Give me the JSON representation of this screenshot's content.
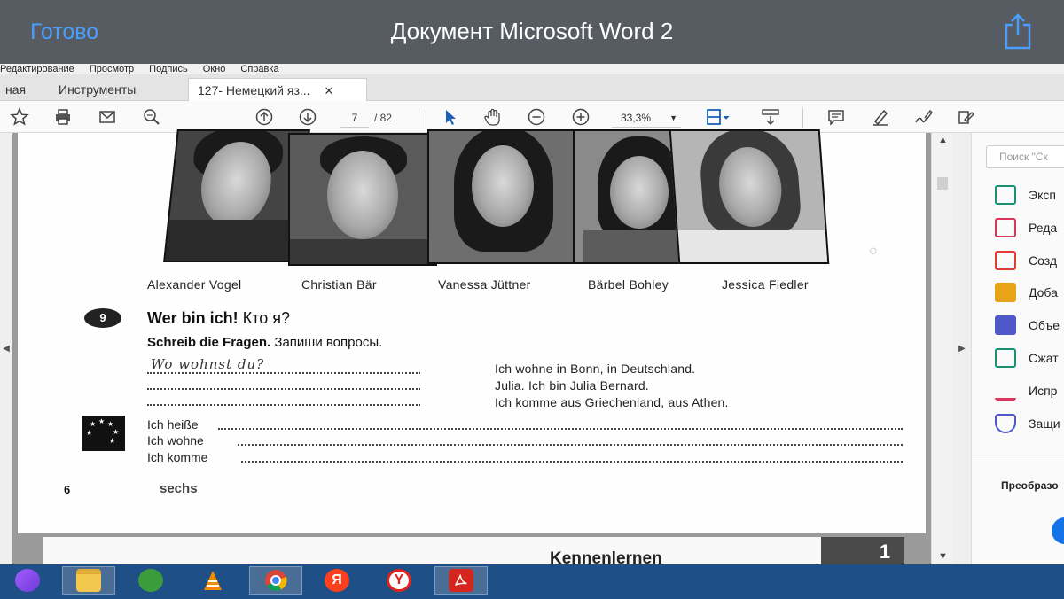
{
  "ios": {
    "done_label": "Готово",
    "title": "Документ Microsoft Word 2"
  },
  "menu": [
    "Редактирование",
    "Просмотр",
    "Подпись",
    "Окно",
    "Справка"
  ],
  "tabs": {
    "home": "ная",
    "tools": "Инструменты",
    "doc": "127- Немецкий яз...",
    "close": "✕"
  },
  "toolbar": {
    "page_current": "7",
    "page_total": "/ 82",
    "zoom": "33,3%",
    "icons": [
      "star-icon",
      "print-icon",
      "mail-icon",
      "search-zoom-icon",
      "page-up-icon",
      "page-down-icon",
      "select-arrow-icon",
      "hand-icon",
      "zoom-out-icon",
      "zoom-in-icon",
      "fit-page-icon",
      "scroll-mode-icon",
      "comment-icon",
      "highlight-icon",
      "sign-icon",
      "fill-sign-icon"
    ]
  },
  "page": {
    "names": [
      "Alexander Vogel",
      "Christian Bär",
      "Vanessa Jüttner",
      "Bärbel Bohley",
      "Jessica Fiedler"
    ],
    "exercise_number": "9",
    "exercise_title_de": "Wer bin ich!",
    "exercise_title_ru": "Кто я?",
    "instruction_de": "Schreib die Fragen.",
    "instruction_ru": "Запиши вопросы.",
    "handwritten": "Wo  wohnst  du?",
    "answers": [
      "Ich wohne in Bonn, in Deutschland.",
      "Julia. Ich bin Julia Bernard.",
      "Ich komme aus Griechenland, aus Athen."
    ],
    "fill_lines": [
      "Ich heiße",
      "Ich wohne",
      "Ich komme"
    ],
    "page_number": "6",
    "page_word": "sechs",
    "next_chapter": "Kennenlernen",
    "next_chapter_number": "1"
  },
  "right_panel": {
    "search_placeholder": "Поиск \"Ск",
    "tools": [
      {
        "label": "Эксп",
        "color": "#1a8f72"
      },
      {
        "label": "Реда",
        "color": "#d9365e"
      },
      {
        "label": "Созд",
        "color": "#e03c31"
      },
      {
        "label": "Доба",
        "color": "#e8a317"
      },
      {
        "label": "Объе",
        "color": "#4f58c9"
      },
      {
        "label": "Сжат",
        "color": "#1a8f72"
      },
      {
        "label": "Испр",
        "color": "#d9365e"
      },
      {
        "label": "Защи",
        "color": "#4f58c9"
      }
    ],
    "convert_label": "Преобразо"
  },
  "taskbar": {
    "items": [
      "alice-icon",
      "file-explorer-icon",
      "security-app-icon",
      "vlc-icon",
      "chrome-icon",
      "yandex-icon",
      "yandex-browser-icon",
      "acrobat-icon"
    ],
    "yandex_letter": "Я",
    "yabrowser_letter": "Y"
  }
}
